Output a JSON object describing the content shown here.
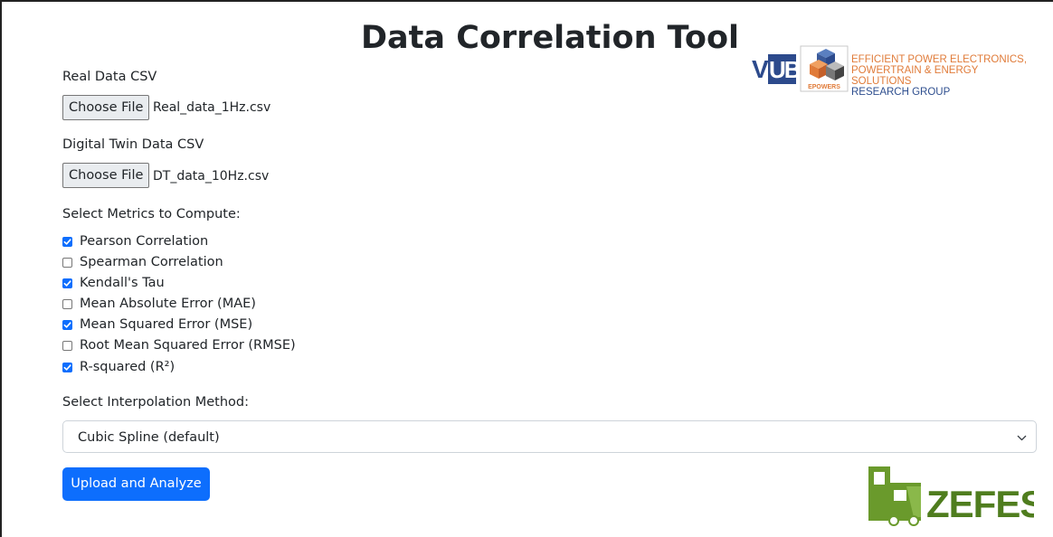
{
  "title": "Data Correlation Tool",
  "real_data": {
    "label": "Real Data CSV",
    "button": "Choose File",
    "file": "Real_data_1Hz.csv"
  },
  "twin_data": {
    "label": "Digital Twin Data CSV",
    "button": "Choose File",
    "file": "DT_data_10Hz.csv"
  },
  "metrics": {
    "label": "Select Metrics to Compute:",
    "items": [
      {
        "label": "Pearson Correlation",
        "checked": true
      },
      {
        "label": "Spearman Correlation",
        "checked": false
      },
      {
        "label": "Kendall's Tau",
        "checked": true
      },
      {
        "label": "Mean Absolute Error (MAE)",
        "checked": false
      },
      {
        "label": "Mean Squared Error (MSE)",
        "checked": true
      },
      {
        "label": "Root Mean Squared Error (RMSE)",
        "checked": false
      },
      {
        "label": "R-squared (R²)",
        "checked": true
      }
    ]
  },
  "interpolation": {
    "label": "Select Interpolation Method:",
    "selected": "Cubic Spline (default)"
  },
  "submit_label": "Upload and Analyze",
  "logos": {
    "vub": "VUB",
    "epowers_line1": "EFFICIENT POWER ELECTRONICS,",
    "epowers_line2": "POWERTRAIN & ENERGY SOLUTIONS",
    "epowers_line3": "RESEARCH GROUP",
    "epowers_small": "EPOWERS",
    "zefes": "ZEFES"
  },
  "colors": {
    "primary": "#0d6efd",
    "epowers_orange": "#e07b39",
    "vub_blue": "#2c4a8c",
    "zefes_green": "#6a9a2c"
  }
}
